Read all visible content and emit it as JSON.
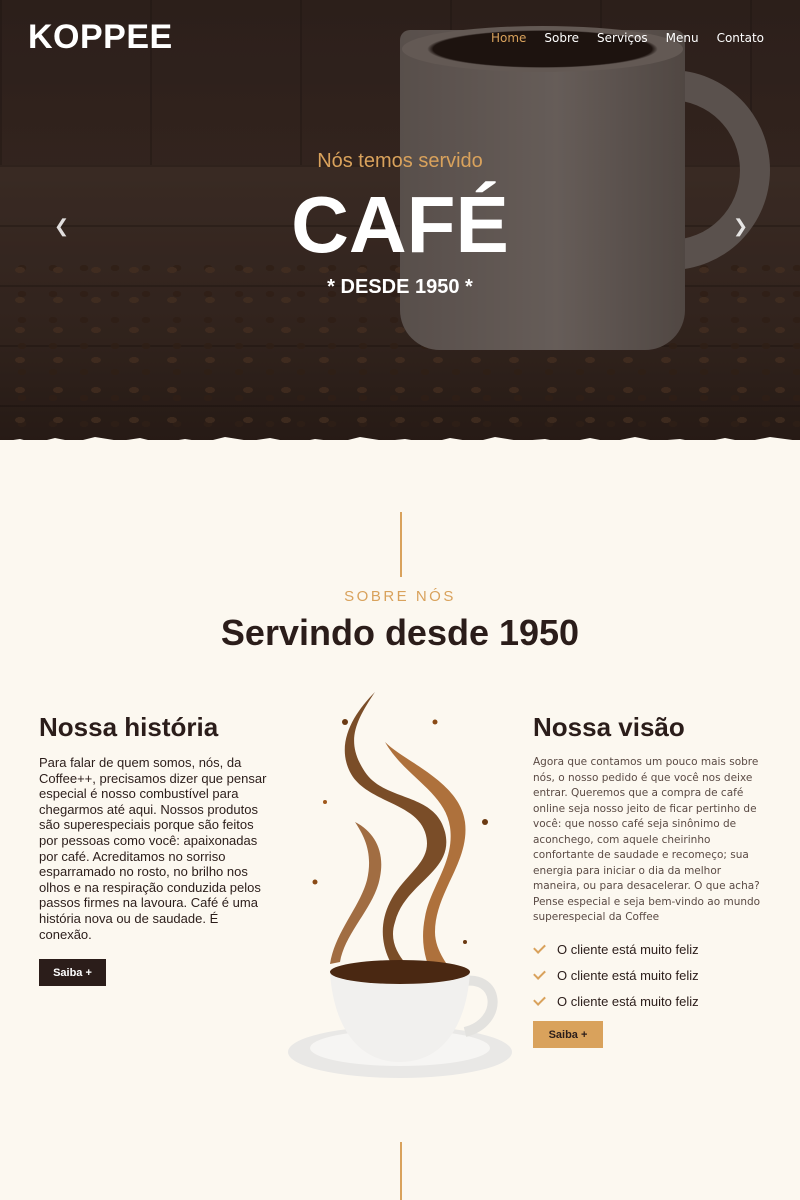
{
  "brand": {
    "logo": "KOPPEE"
  },
  "nav": [
    {
      "label": "Home",
      "active": true
    },
    {
      "label": "Sobre",
      "active": false
    },
    {
      "label": "Serviços",
      "active": false
    },
    {
      "label": "Menu",
      "active": false
    },
    {
      "label": "Contato",
      "active": false
    }
  ],
  "hero": {
    "subtitle": "Nós temos servido",
    "title": "CAFÉ",
    "since": "* DESDE 1950 *",
    "prev_icon": "chevron-left-icon",
    "next_icon": "chevron-right-icon"
  },
  "about": {
    "kicker": "SOBRE NÓS",
    "title": "Servindo desde 1950",
    "history": {
      "title": "Nossa história",
      "text": "Para falar de quem somos, nós, da Coffee++, precisamos dizer que pensar especial é nosso combustível para chegarmos até aqui. Nossos produtos são superespeciais porque são feitos por pessoas como você: apaixonadas por café. Acreditamos no sorriso esparramado no rosto, no brilho nos olhos e na respiração conduzida pelos passos firmes na lavoura. Café é uma história nova ou de saudade. É conexão.",
      "button": "Saiba +"
    },
    "vision": {
      "title": "Nossa visão",
      "text": "Agora que contamos um pouco mais sobre nós, o nosso pedido é que você nos deixe entrar. Queremos que a compra de café online seja nosso jeito de ficar pertinho de você: que nosso café seja sinônimo de aconchego, com aquele cheirinho confortante de saudade e recomeço; sua energia para iniciar o dia da melhor maneira, ou para desacelerar. O que acha? Pense especial e seja bem-vindo ao mundo superespecial da Coffee",
      "checks": [
        "O cliente está muito feliz",
        "O cliente está muito feliz",
        "O cliente está muito feliz"
      ],
      "button": "Saiba +"
    }
  },
  "colors": {
    "accent": "#d9a25c",
    "dark": "#2b1d1a",
    "background": "#fcf8f0"
  }
}
